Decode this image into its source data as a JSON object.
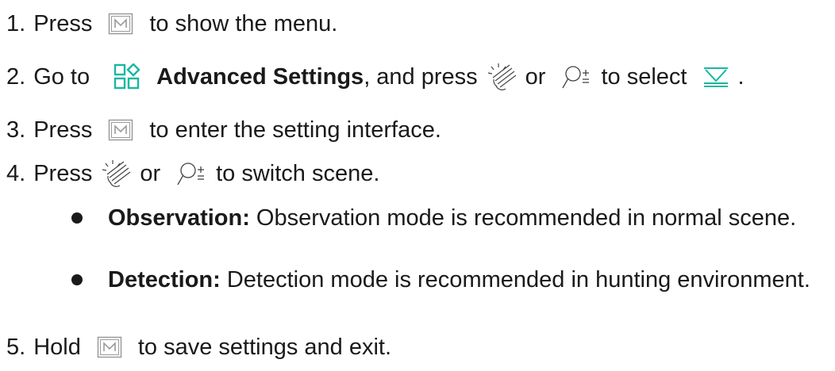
{
  "steps": [
    {
      "number": "1.",
      "parts": [
        "Press",
        "to show the menu."
      ]
    },
    {
      "number": "2.",
      "parts": [
        "Go to",
        "Advanced Settings",
        ", and press",
        "or",
        "to select",
        "."
      ]
    },
    {
      "number": "3.",
      "parts": [
        "Press",
        "to enter the setting interface."
      ]
    },
    {
      "number": "4.",
      "parts": [
        "Press",
        "or",
        "to switch scene."
      ],
      "bullets": [
        {
          "term": "Observation:",
          "text": " Observation mode is recommended in normal scene."
        },
        {
          "term": "Detection:",
          "text": " Detection mode is recommended in hunting environment."
        }
      ]
    },
    {
      "number": "5.",
      "parts": [
        "Hold",
        "to save settings and exit."
      ]
    }
  ],
  "icons": {
    "menu_key": "m-key-icon",
    "advanced_settings": "advanced-settings-icon",
    "brightness": "brightness-icon",
    "zoom": "zoom-icon",
    "scene": "scene-icon"
  },
  "colors": {
    "accent": "#18b8a0",
    "text": "#1a1a1a",
    "icon_gray": "#9a9a9a"
  }
}
